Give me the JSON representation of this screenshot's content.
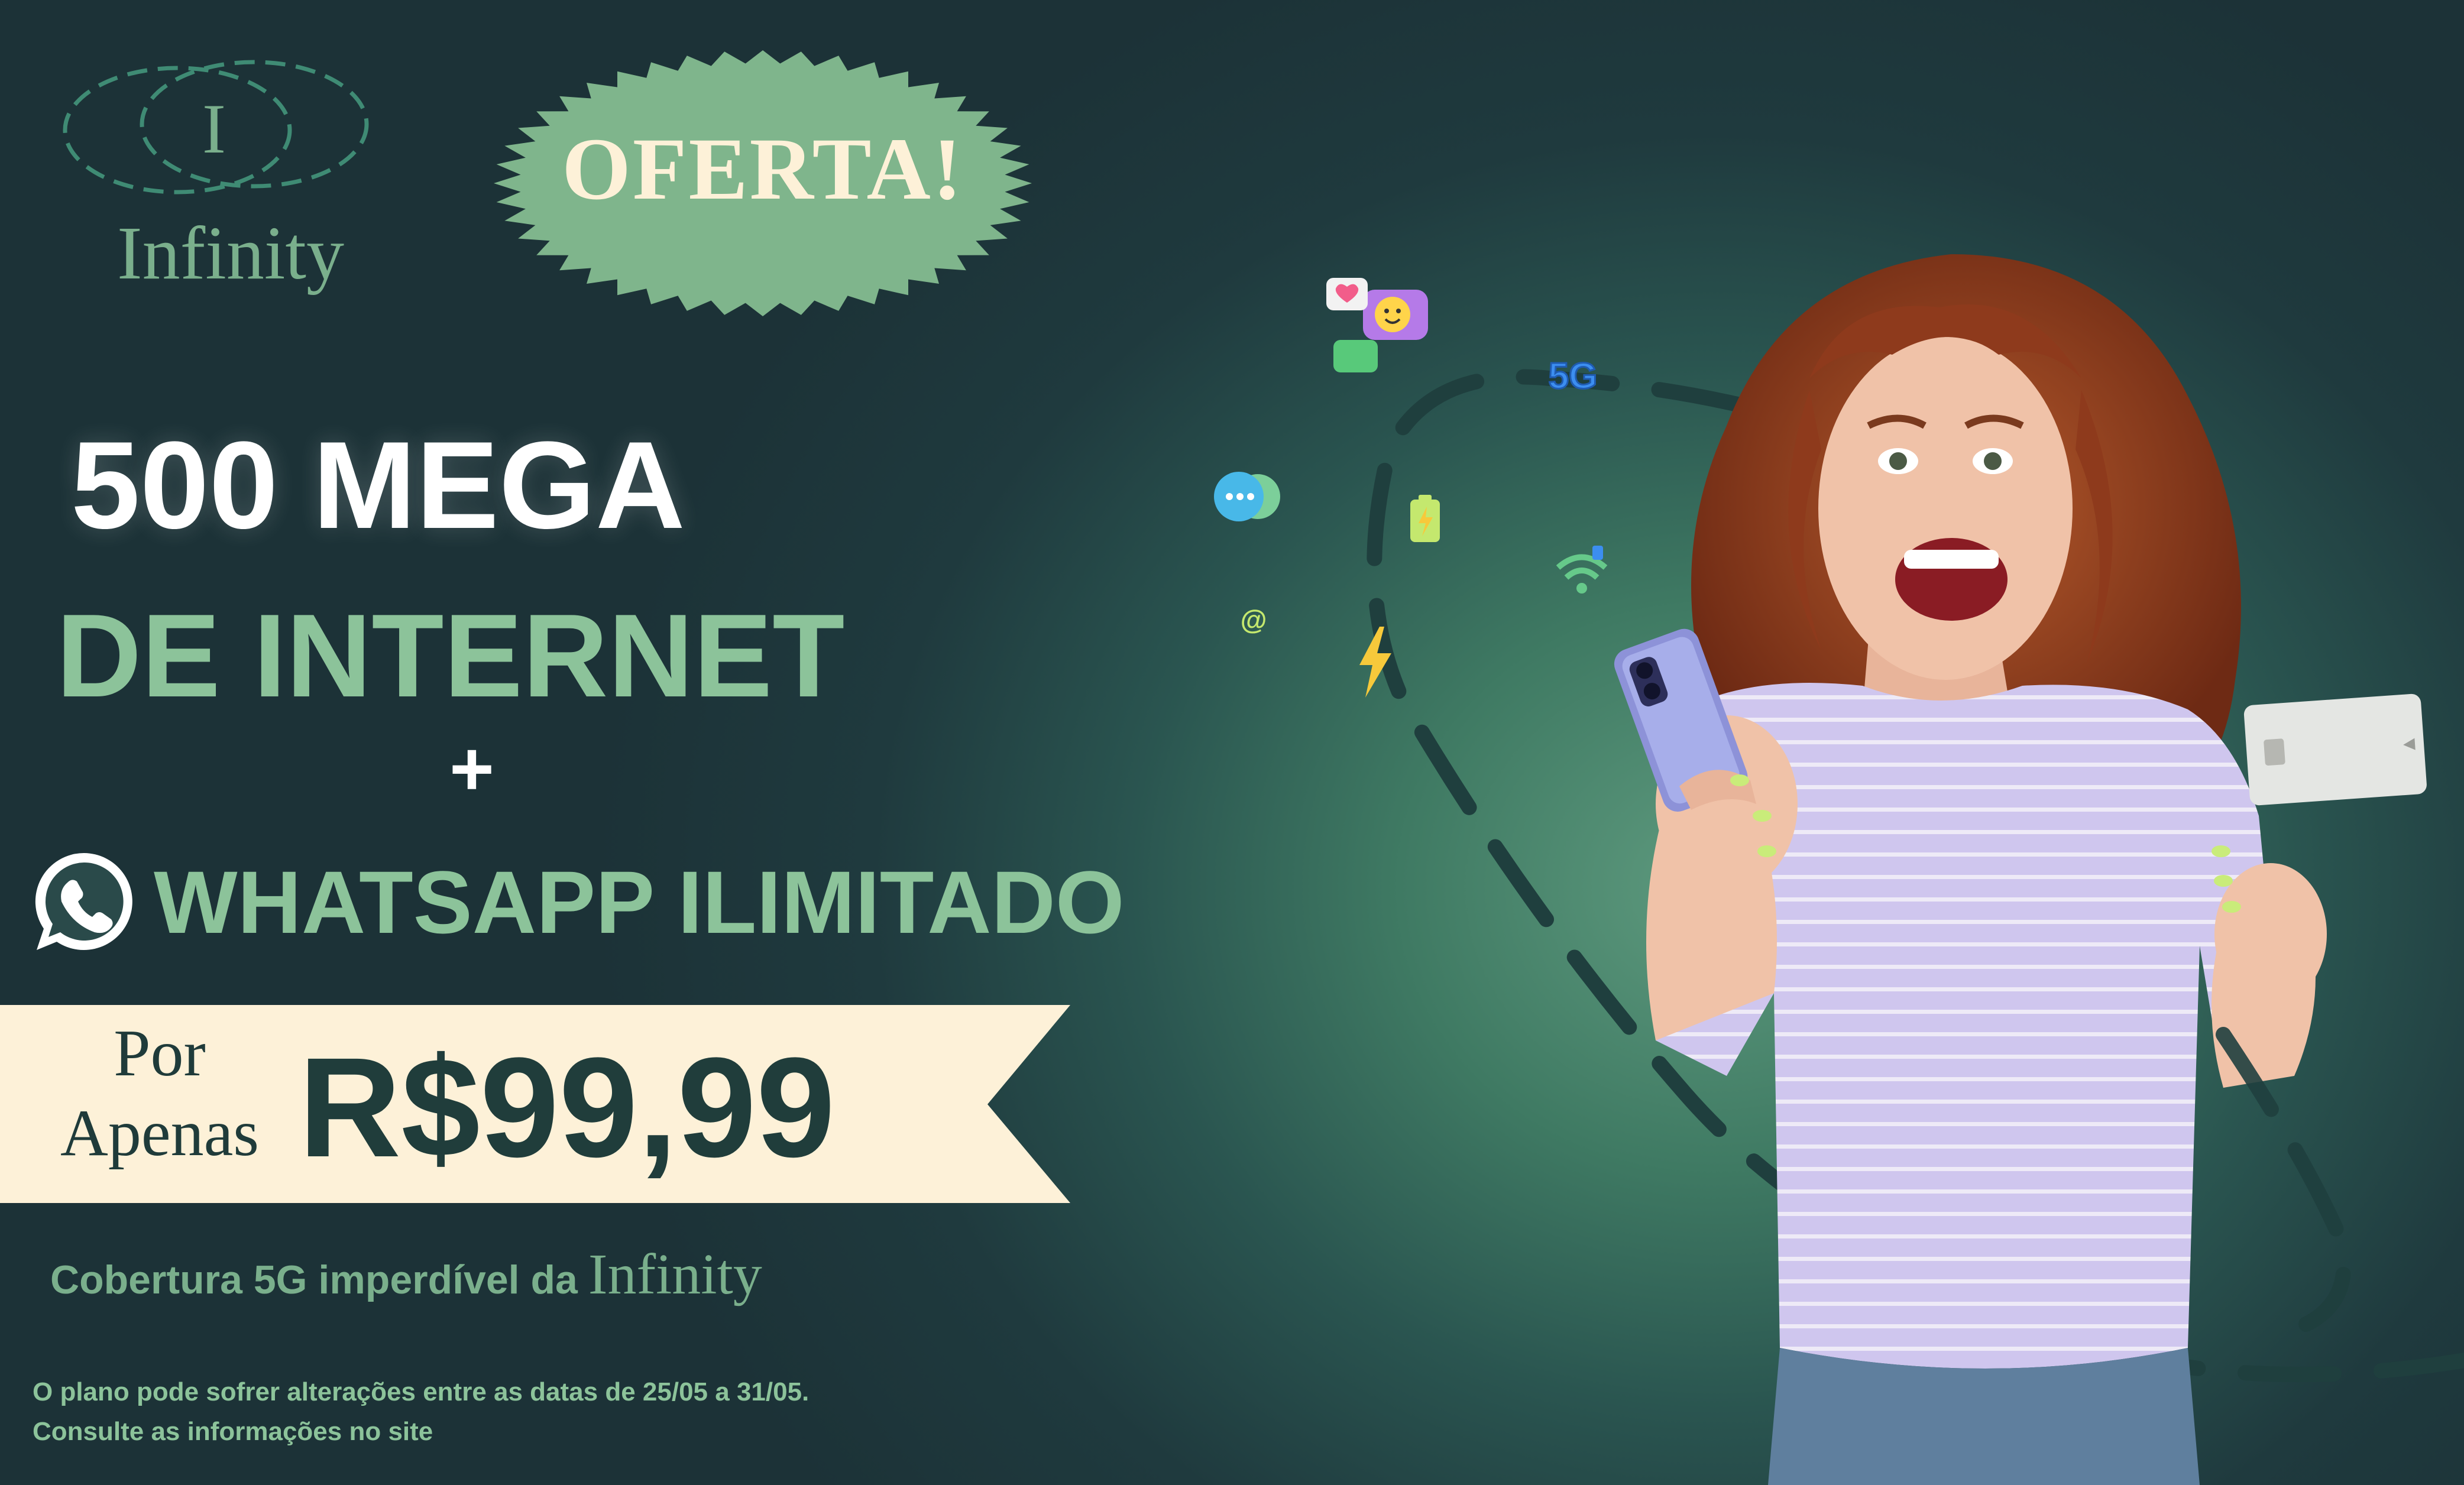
{
  "brand": {
    "logo_letter": "I",
    "name": "Infinity"
  },
  "badge": {
    "text": "OFERTA!"
  },
  "headline": {
    "line1": "500 MEGA",
    "line2": "DE INTERNET",
    "plus": "+",
    "line3": "WHATSAPP ILIMITADO"
  },
  "price": {
    "prefix_line1": "Por",
    "prefix_line2": "Apenas",
    "value": "R$99,99"
  },
  "tagline": {
    "text": "Cobertura 5G imperdível da",
    "brand": "Infinity"
  },
  "disclaimer": {
    "line1": "O plano pode sofrer alterações entre as datas de 25/05 a 31/05.",
    "line2": "Consulte as informações no site"
  },
  "floating_icons": {
    "fiveg_label": "5G",
    "at_label": "@"
  },
  "colors": {
    "background_dark": "#1c3237",
    "accent_green": "#8cc39a",
    "badge_fill": "#7fb58c",
    "banner_fill": "#fdf1d8",
    "price_text": "#203d3b",
    "shirt": "#d6cdf0",
    "hair": "#8e3a1c"
  },
  "icons": [
    "logo-rings-icon",
    "whatsapp-icon",
    "chat-bubble-icon",
    "5g-icon",
    "wifi-icon",
    "battery-icon",
    "lightning-icon",
    "at-icon",
    "smartphone-icon",
    "credit-card-icon"
  ]
}
